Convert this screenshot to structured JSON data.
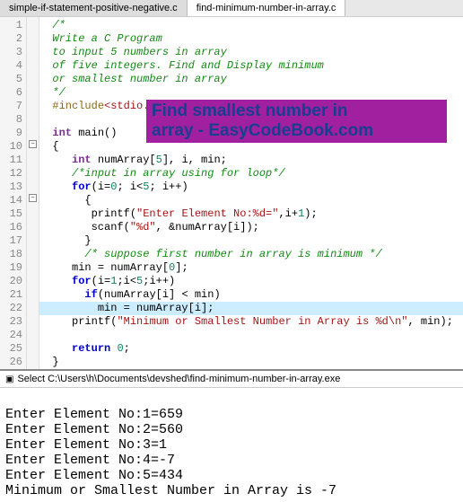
{
  "tabs": {
    "tab1": "simple-if-statement-positive-negative.c",
    "tab2": "find-minimum-number-in-array.c"
  },
  "gutter": [
    "1",
    "2",
    "3",
    "4",
    "5",
    "6",
    "7",
    "8",
    "9",
    "10",
    "11",
    "12",
    "13",
    "14",
    "15",
    "16",
    "17",
    "18",
    "19",
    "20",
    "21",
    "22",
    "23",
    "24",
    "25",
    "26"
  ],
  "code": {
    "l1": "/*",
    "l2": "Write a C Program",
    "l3": "to input 5 numbers in array",
    "l4": "of five integers. Find and Display minimum",
    "l5": "or smallest number in array",
    "l6": "*/",
    "l7a": "#include",
    "l7b": "<stdio.h>",
    "l9a": "int",
    "l9b": " main()",
    "l10": "{",
    "l11a": "int",
    "l11b": " numArray[",
    "l11c": "5",
    "l11d": "], i, min;",
    "l12": "/*input in array using for loop*/",
    "l13a": "for",
    "l13b": "(i=",
    "l13c": "0",
    "l13d": "; i<",
    "l13e": "5",
    "l13f": "; i++)",
    "l14": "{",
    "l15a": "printf(",
    "l15b": "\"Enter Element No:%d=\"",
    "l15c": ",i+",
    "l15d": "1",
    "l15e": ");",
    "l16a": "scanf(",
    "l16b": "\"%d\"",
    "l16c": ", &numArray[i]);",
    "l17": "}",
    "l18": "/* suppose first number in array is minimum */",
    "l19a": "min = numArray[",
    "l19b": "0",
    "l19c": "];",
    "l20a": "for",
    "l20b": "(i=",
    "l20c": "1",
    "l20d": ";i<",
    "l20e": "5",
    "l20f": ";i++)",
    "l21a": "if",
    "l21b": "(numArray[i] < min)",
    "l22": "min = numArray[i];",
    "l23a": "printf(",
    "l23b": "\"Minimum or Smallest Number in Array is %d\\n\"",
    "l23c": ", min);",
    "l25a": "return",
    "l25b": " ",
    "l25c": "0",
    "l25d": ";",
    "l26": "}"
  },
  "overlay": {
    "line1": "Find smallest number in",
    "line2": "array - EasyCodeBook.com"
  },
  "console": {
    "title_prefix": "Select ",
    "title_path": "C:\\Users\\h\\Documents\\devshed\\find-minimum-number-in-array.exe",
    "out1": "Enter Element No:1=659",
    "out2": "Enter Element No:2=560",
    "out3": "Enter Element No:3=1",
    "out4": "Enter Element No:4=-7",
    "out5": "Enter Element No:5=434",
    "out6": "Minimum or Smallest Number in Array is -7"
  }
}
